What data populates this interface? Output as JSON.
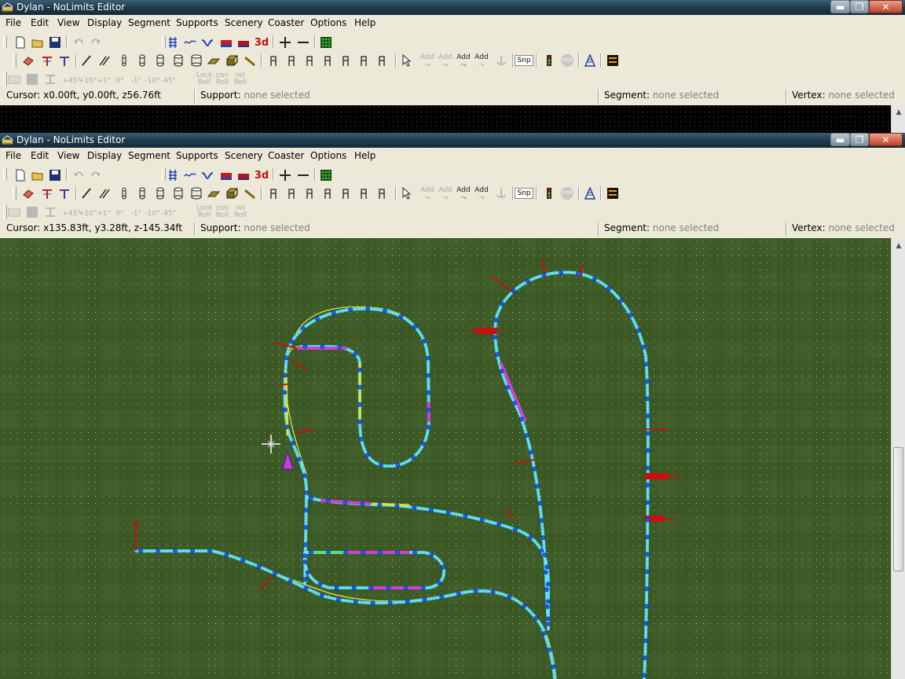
{
  "windows": [
    {
      "title": "Dylan - NoLimits Editor",
      "menu": [
        "File",
        "Edit",
        "View",
        "Display",
        "Segment",
        "Supports",
        "Scenery",
        "Coaster",
        "Options",
        "Help"
      ],
      "status": {
        "cursor_label": "Cursor:",
        "cursor_value": "x0.00ft, y0.00ft, z56.76ft",
        "support_label": "Support:",
        "support_value": "none selected",
        "segment_label": "Segment:",
        "segment_value": "none selected",
        "vertex_label": "Vertex:",
        "vertex_value": "none selected"
      }
    },
    {
      "title": "Dylan - NoLimits Editor",
      "menu": [
        "File",
        "Edit",
        "View",
        "Display",
        "Segment",
        "Supports",
        "Scenery",
        "Coaster",
        "Options",
        "Help"
      ],
      "status": {
        "cursor_label": "Cursor:",
        "cursor_value": "x135.83ft, y3.28ft, z-145.34ft",
        "support_label": "Support:",
        "support_value": "none selected",
        "segment_label": "Segment:",
        "segment_value": "none selected",
        "vertex_label": "Vertex:",
        "vertex_value": "none selected"
      }
    }
  ],
  "toolbar": {
    "threed_label": "3d",
    "snap_label": "Snp",
    "stop_label": "STOP",
    "add_labels": [
      "Add",
      "Add",
      "Add",
      "Add"
    ],
    "angle_labels": [
      "+45°",
      "+10°",
      "+1°",
      "0°",
      "-1°",
      "-10°",
      "-45°"
    ],
    "lock_labels": [
      "Lock Roll",
      "con Roll",
      "rel Roll"
    ]
  },
  "colors": {
    "grass": "#3c5a26",
    "track_rail": "#40d0e8",
    "track_yellow": "#e8e840",
    "node_blue": "#1a5cff",
    "support_red": "#c81010",
    "magenta": "#d040d0"
  }
}
